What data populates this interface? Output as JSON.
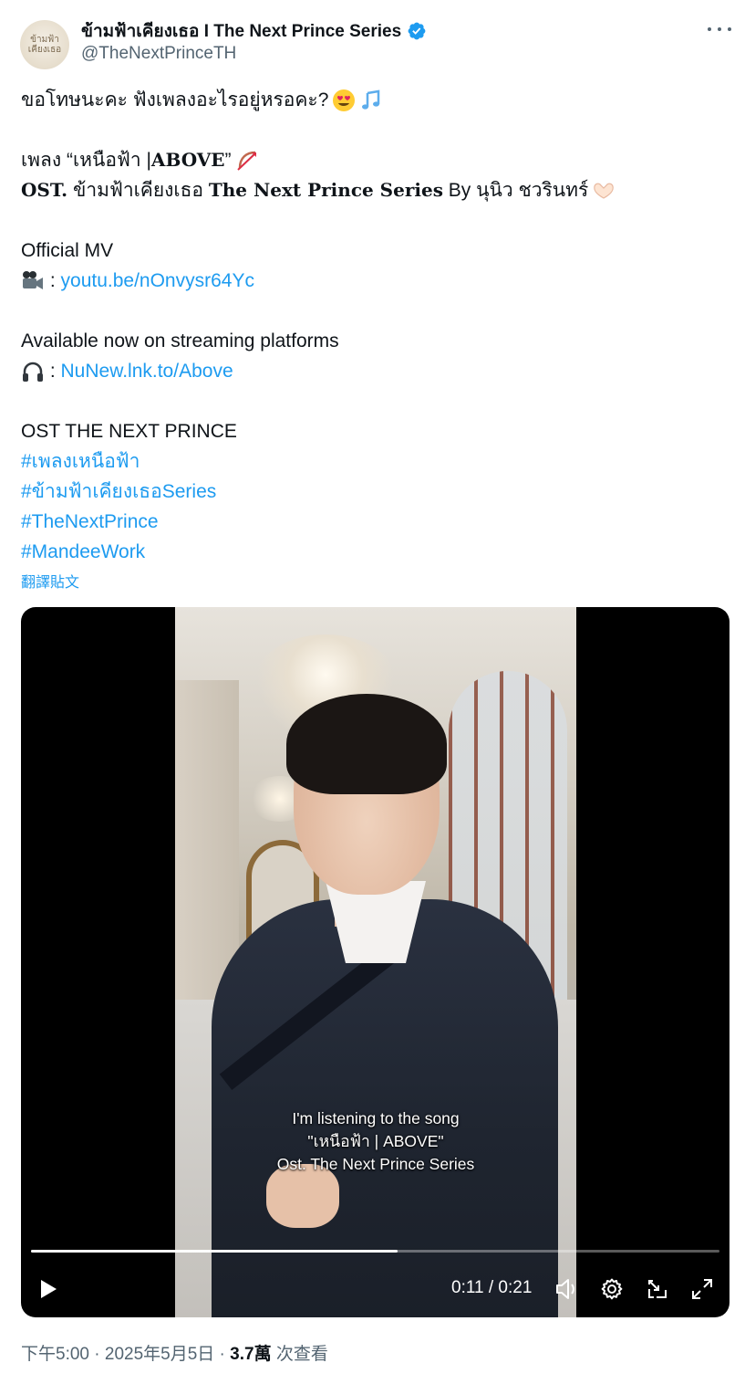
{
  "account": {
    "avatar_text": "ข้ามฟ้า เคียงเธอ",
    "display_name": "ข้ามฟ้าเคียงเธอ I The Next Prince Series",
    "handle": "@TheNextPrinceTH",
    "verified": true,
    "more_icon": "more-horizontal-icon"
  },
  "tweet": {
    "line1": "ขอโทษนะคะ ฟังเพลงอะไรอยู่หรอคะ?",
    "line1_emojis": [
      "heart-eyes-emoji",
      "music-notes-emoji"
    ],
    "song_prefix": "เพลง “เหนือฟ้า | ",
    "song_title": "ABOVE",
    "song_suffix": "”",
    "song_emoji": "bow-and-arrow-emoji",
    "ost_prefix": "OST.",
    "ost_thai": " ข้ามฟ้าเคียงเธอ ",
    "ost_series": "The Next Prince Series",
    "ost_by": " By นุนิว ชวรินทร์",
    "ost_emoji": "heart-hands-emoji",
    "mv_label": "Official MV",
    "mv_emoji": "movie-camera-emoji",
    "mv_sep": " : ",
    "mv_link": "youtu.be/nOnvysr64Yc",
    "streaming_label": "Available now on streaming platforms",
    "streaming_emoji": "headphones-emoji",
    "streaming_sep": " : ",
    "streaming_link": "NuNew.lnk.to/Above",
    "ost_caps": "OST THE NEXT PRINCE",
    "hashtags": [
      "#เพลงเหนือฟ้า",
      "#ข้ามฟ้าเคียงเธอSeries",
      "#TheNextPrince",
      "#MandeeWork"
    ],
    "translate": "翻譯貼文"
  },
  "video": {
    "subtitle_lines": [
      "I'm listening to the song",
      "\"เหนือฟ้า | ABOVE\"",
      "Ost. The Next Prince Series"
    ],
    "current_time": "0:11",
    "time_sep": " / ",
    "duration": "0:21",
    "progress_fraction": 0.532,
    "icons": [
      "play-icon",
      "volume-icon",
      "settings-icon",
      "pip-icon",
      "fullscreen-icon"
    ]
  },
  "meta": {
    "time": "下午5:00",
    "sep1": " · ",
    "date": "2025年5月5日",
    "sep2": " · ",
    "views": "3.7萬",
    "views_label": " 次查看"
  },
  "colors": {
    "link": "#1d9bf0",
    "secondary_text": "#536471",
    "primary_text": "#0f1419",
    "verified": "#1d9bf0"
  }
}
